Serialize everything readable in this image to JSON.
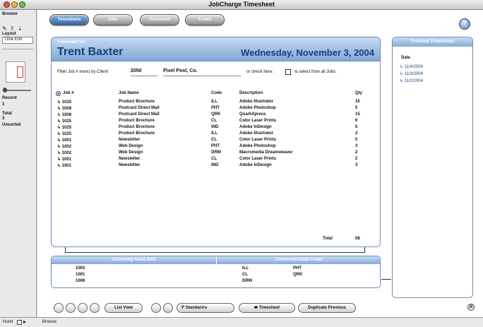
{
  "window": {
    "title": "JobCharge Timesheet"
  },
  "status_area": {
    "browse_label": "Browse",
    "layout_label": "Layout",
    "layout_value": "Time Entr",
    "record_label": "Record",
    "record_value": "1",
    "total_label": "Total",
    "total_value": "3",
    "unsorted_label": "Unsorted"
  },
  "bottom_bar": {
    "zoom_label": "Hund",
    "mode_label": "Browse"
  },
  "tabs": [
    {
      "label": "Timesheets",
      "active": true
    },
    {
      "label": "Jobs",
      "active": false
    },
    {
      "label": "Personnel",
      "active": false
    },
    {
      "label": "Codes",
      "active": false
    }
  ],
  "timesheet": {
    "header_label": "Timesheet for:",
    "name": "Trent Baxter",
    "date": "Wednesday, November 3, 2004",
    "filter_label": "Filter Job # menu by Client:",
    "client_id": "2050",
    "client_name": "Pixel Post, Co.",
    "check_text": "or check here:",
    "check_suffix": "to select from all Jobs."
  },
  "table": {
    "headers": {
      "job": "Job #",
      "job_name": "Job Name",
      "code": "Code",
      "description": "Description",
      "qty": "Qty"
    },
    "rows": [
      {
        "job": "1025",
        "job_name": "Product Brochure",
        "code": "ILL",
        "description": "Adobe Illustrator",
        "qty": "10"
      },
      {
        "job": "1008",
        "job_name": "Postcard Direct Mail",
        "code": "PHT",
        "description": "Adobe Photoshop",
        "qty": "5"
      },
      {
        "job": "1008",
        "job_name": "Postcard Direct Mail",
        "code": "QRK",
        "description": "QuarkXpress",
        "qty": "15"
      },
      {
        "job": "1025",
        "job_name": "Product Brochure",
        "code": "CL",
        "description": "Color Laser Prints",
        "qty": "6"
      },
      {
        "job": "1025",
        "job_name": "Product Brochure",
        "code": "IND",
        "description": "Adobe InDesign",
        "qty": "5"
      },
      {
        "job": "1025",
        "job_name": "Product Brochure",
        "code": "ILL",
        "description": "Adobe Illustrator",
        "qty": "2"
      },
      {
        "job": "1001",
        "job_name": "Newsletter",
        "code": "CL",
        "description": "Color Laser Prints",
        "qty": "5"
      },
      {
        "job": "1002",
        "job_name": "Web Design",
        "code": "PHT",
        "description": "Adobe Photoshop",
        "qty": "3"
      },
      {
        "job": "1002",
        "job_name": "Web Design",
        "code": "DRW",
        "description": "Macromedia Dreamweaver",
        "qty": "2"
      },
      {
        "job": "1001",
        "job_name": "Newsletter",
        "code": "CL",
        "description": "Color Laser Prints",
        "qty": "2"
      },
      {
        "job": "1001",
        "job_name": "Newsletter",
        "code": "IND",
        "description": "Adobe InDesign",
        "qty": "3"
      }
    ],
    "total_label": "Total",
    "total_value": "58"
  },
  "commonly_used": {
    "jobs_header": "Commonly Used Jobs",
    "codes_header": "Commonly Used Codes",
    "jobs": [
      "1002",
      "1001",
      "1006"
    ],
    "codes_left": [
      "ILL",
      "CL",
      "DRW"
    ],
    "codes_right": [
      "PHT",
      "QRK"
    ]
  },
  "previous": {
    "header": "Previous Timesheets",
    "column": "Date",
    "dates": [
      "11/4/2004",
      "11/3/2004",
      "11/2/2004"
    ]
  },
  "buttons": {
    "list_view": "List View",
    "standard": "Standard",
    "timesheet": "Timesheet",
    "duplicate": "Duplicate Previous"
  },
  "help_icon": "help-icon"
}
